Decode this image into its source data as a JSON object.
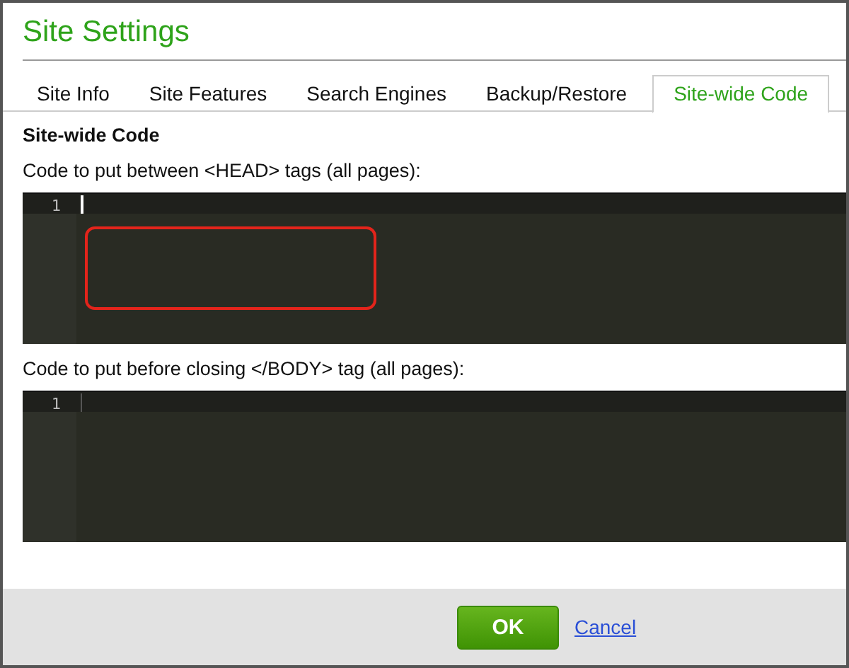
{
  "window": {
    "title": "Site Settings"
  },
  "tabs": [
    {
      "label": "Site Info",
      "selected": false
    },
    {
      "label": "Site Features",
      "selected": false
    },
    {
      "label": "Search Engines",
      "selected": false
    },
    {
      "label": "Backup/Restore",
      "selected": false
    },
    {
      "label": "Site-wide Code",
      "selected": true
    }
  ],
  "section": {
    "heading": "Site-wide Code"
  },
  "editors": [
    {
      "label": "Code to put between <HEAD> tags (all pages):",
      "line_numbers": [
        "1"
      ],
      "focused": true,
      "highlight": true
    },
    {
      "label": "Code to put before closing </BODY> tag (all pages):",
      "line_numbers": [
        "1"
      ],
      "focused": false,
      "highlight": false
    }
  ],
  "buttons": [
    {
      "kind": "primary",
      "label": "OK"
    },
    {
      "kind": "link",
      "label": "Cancel"
    }
  ]
}
